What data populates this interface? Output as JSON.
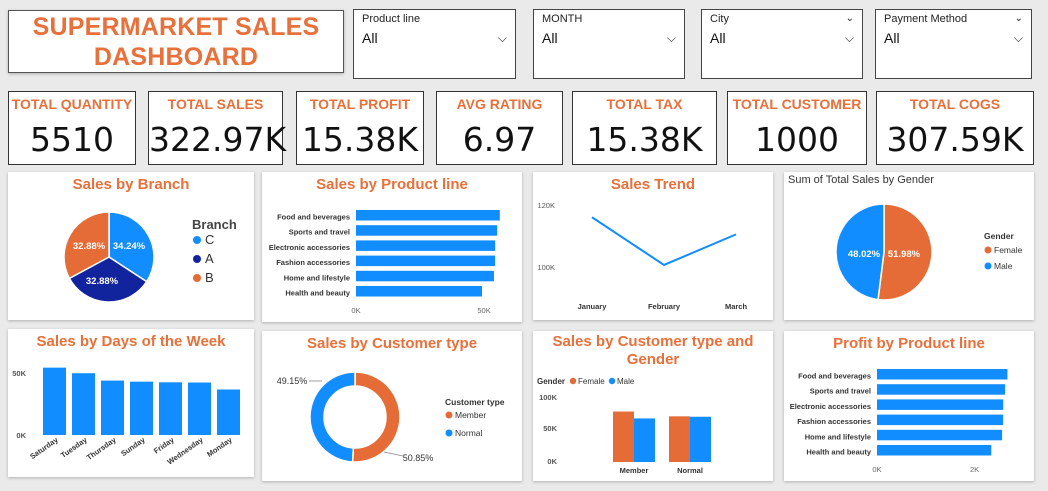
{
  "header": {
    "title_line1": "SUPERMARKET SALES",
    "title_line2": "DASHBOARD"
  },
  "slicers": [
    {
      "label": "Product line",
      "value": "All"
    },
    {
      "label": "MONTH",
      "value": "All"
    },
    {
      "label": "City",
      "value": "All"
    },
    {
      "label": "Payment Method",
      "value": "All"
    }
  ],
  "kpis": [
    {
      "label": "TOTAL QUANTITY",
      "value": "5510"
    },
    {
      "label": "TOTAL SALES",
      "value": "322.97K"
    },
    {
      "label": "TOTAL PROFIT",
      "value": "15.38K"
    },
    {
      "label": "AVG RATING",
      "value": "6.97"
    },
    {
      "label": "TOTAL TAX",
      "value": "15.38K"
    },
    {
      "label": "TOTAL CUSTOMER",
      "value": "1000"
    },
    {
      "label": "TOTAL COGS",
      "value": "307.59K"
    }
  ],
  "colors": {
    "accent": "#e8703a",
    "blue": "#118dff",
    "navy": "#12239e",
    "orange": "#e66c37"
  },
  "chart_data": [
    {
      "id": "branch",
      "type": "pie",
      "title": "Sales by Branch",
      "legend_title": "Branch",
      "legend_position": "right",
      "labels": [
        "C",
        "A",
        "B"
      ],
      "values": [
        34.24,
        32.88,
        32.88
      ],
      "value_labels": [
        "34.24%",
        "32.88%",
        "32.88%"
      ],
      "colors": [
        "#118dff",
        "#12239e",
        "#e66c37"
      ]
    },
    {
      "id": "product",
      "type": "bar",
      "orientation": "horizontal",
      "title": "Sales by Product line",
      "categories": [
        "Food and beverages",
        "Sports and travel",
        "Electronic accessories",
        "Fashion accessories",
        "Home and lifestyle",
        "Health and beauty"
      ],
      "values": [
        56145,
        55123,
        54338,
        54306,
        53862,
        49194
      ],
      "xlim": [
        0,
        57000
      ],
      "xticks": [
        "0K",
        "50K"
      ]
    },
    {
      "id": "trend",
      "type": "line",
      "title": "Sales Trend",
      "categories": [
        "January",
        "February",
        "March"
      ],
      "values": [
        116292,
        97219,
        109456
      ],
      "ylim": [
        90000,
        120000
      ],
      "yticks": [
        "120K",
        "100K"
      ]
    },
    {
      "id": "gender",
      "type": "pie",
      "title": "Sum of Total Sales by Gender",
      "legend_title": "Gender",
      "legend_position": "right",
      "labels": [
        "Female",
        "Male"
      ],
      "values": [
        51.98,
        48.02
      ],
      "value_labels": [
        "51.98%",
        "48.02%"
      ],
      "colors": [
        "#e66c37",
        "#118dff"
      ]
    },
    {
      "id": "days",
      "type": "bar",
      "title": "Sales by Days of the Week",
      "categories": [
        "Saturday",
        "Tuesday",
        "Thursday",
        "Sunday",
        "Friday",
        "Wednesday",
        "Monday"
      ],
      "values": [
        56120,
        51482,
        45349,
        44458,
        43926,
        43731,
        37899
      ],
      "ylim": [
        0,
        60000
      ],
      "yticks": [
        "50K",
        "0K"
      ]
    },
    {
      "id": "custtype",
      "type": "pie",
      "subtype": "donut",
      "title": "Sales by Customer type",
      "legend_title": "Customer type",
      "legend_position": "right",
      "labels": [
        "Member",
        "Normal"
      ],
      "values": [
        50.85,
        49.15
      ],
      "value_labels": [
        "50.85%",
        "49.15%"
      ],
      "colors": [
        "#e66c37",
        "#118dff"
      ]
    },
    {
      "id": "custgender",
      "type": "bar",
      "title": "Sales by Customer type and Gender",
      "legend_title": "Gender",
      "legend_position": "top-left",
      "categories": [
        "Member",
        "Normal"
      ],
      "series": [
        {
          "name": "Female",
          "values": [
            88146,
            79736
          ],
          "color": "#e66c37"
        },
        {
          "name": "Male",
          "values": [
            76076,
            79020
          ],
          "color": "#118dff"
        }
      ],
      "ylim": [
        0,
        110000
      ],
      "yticks": [
        "100K",
        "50K",
        "0K"
      ]
    },
    {
      "id": "profit",
      "type": "bar",
      "orientation": "horizontal",
      "title": "Profit by Product line",
      "categories": [
        "Food and beverages",
        "Sports and travel",
        "Electronic accessories",
        "Fashion accessories",
        "Home and lifestyle",
        "Health and beauty"
      ],
      "values": [
        2674,
        2625,
        2588,
        2586,
        2565,
        2343
      ],
      "xlim": [
        0,
        2850
      ],
      "xticks": [
        "0K",
        "2K"
      ]
    }
  ]
}
